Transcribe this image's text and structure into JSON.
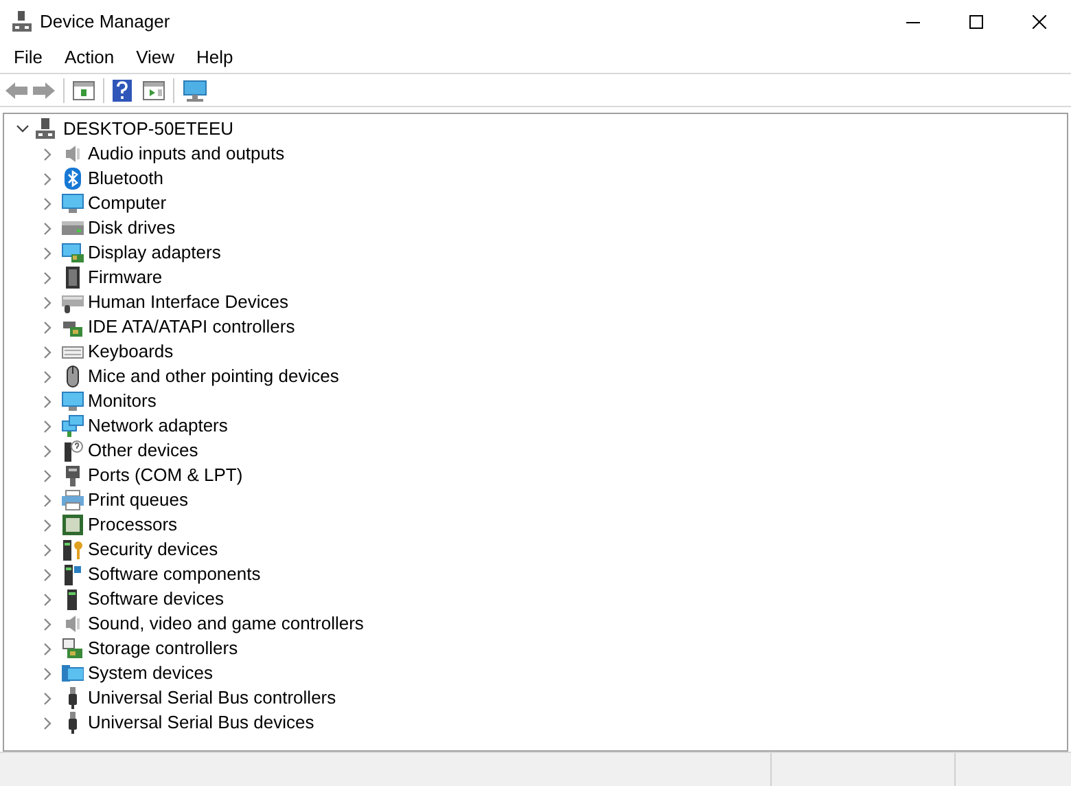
{
  "window": {
    "title": "Device Manager"
  },
  "menu": [
    "File",
    "Action",
    "View",
    "Help"
  ],
  "tree": {
    "label": "DESKTOP-50ETEEU",
    "expanded": true,
    "children": [
      {
        "label": "Audio inputs and outputs",
        "expanded": false
      },
      {
        "label": "Bluetooth",
        "expanded": false
      },
      {
        "label": "Computer",
        "expanded": false
      },
      {
        "label": "Disk drives",
        "expanded": false
      },
      {
        "label": "Display adapters",
        "expanded": false
      },
      {
        "label": "Firmware",
        "expanded": false
      },
      {
        "label": "Human Interface Devices",
        "expanded": false
      },
      {
        "label": "IDE ATA/ATAPI controllers",
        "expanded": false
      },
      {
        "label": "Keyboards",
        "expanded": false
      },
      {
        "label": "Mice and other pointing devices",
        "expanded": false
      },
      {
        "label": "Monitors",
        "expanded": false
      },
      {
        "label": "Network adapters",
        "expanded": false
      },
      {
        "label": "Other devices",
        "expanded": false
      },
      {
        "label": "Ports (COM & LPT)",
        "expanded": false
      },
      {
        "label": "Print queues",
        "expanded": false
      },
      {
        "label": "Processors",
        "expanded": false
      },
      {
        "label": "Security devices",
        "expanded": false
      },
      {
        "label": "Software components",
        "expanded": false
      },
      {
        "label": "Software devices",
        "expanded": false
      },
      {
        "label": "Sound, video and game controllers",
        "expanded": false
      },
      {
        "label": "Storage controllers",
        "expanded": false
      },
      {
        "label": "System devices",
        "expanded": false
      },
      {
        "label": "Universal Serial Bus controllers",
        "expanded": false
      },
      {
        "label": "Universal Serial Bus devices",
        "expanded": false
      }
    ]
  }
}
